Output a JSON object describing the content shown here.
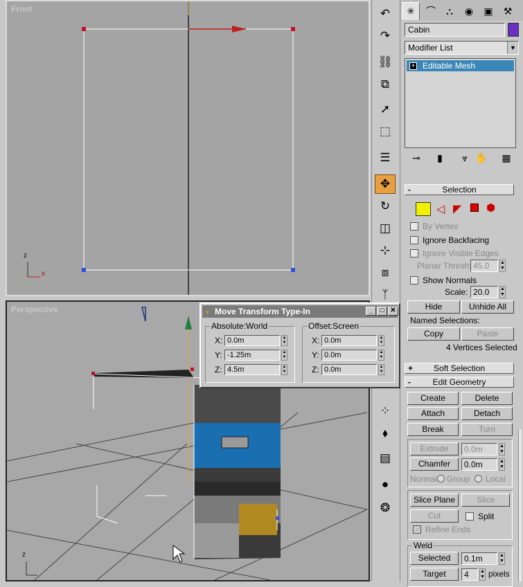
{
  "viewports": {
    "front": {
      "label": "Front",
      "axis_z": "z",
      "axis_x": "x"
    },
    "perspective": {
      "label": "Perspective",
      "axis_z": "z"
    }
  },
  "panel": {
    "object_name": "Cabin",
    "object_color": "#6a2fc0",
    "modifier_list": "Modifier List",
    "stack_item": "Editable Mesh",
    "selection": {
      "title": "Selection",
      "by_vertex": "By Vertex",
      "ignore_backfacing": "Ignore Backfacing",
      "ignore_visible_edges": "Ignore Visible Edges",
      "planar_thresh_label": "Planar Thresh:",
      "planar_thresh_value": "45.0",
      "show_normals": "Show Normals",
      "scale_label": "Scale:",
      "scale_value": "20.0",
      "hide": "Hide",
      "unhide_all": "Unhide All",
      "named_selections": "Named Selections:",
      "copy": "Copy",
      "paste": "Paste",
      "status": "4 Vertices Selected"
    },
    "soft_selection": {
      "title": "Soft Selection"
    },
    "edit_geometry": {
      "title": "Edit Geometry",
      "create": "Create",
      "delete": "Delete",
      "attach": "Attach",
      "detach": "Detach",
      "break": "Break",
      "turn": "Turn",
      "extrude": "Extrude",
      "extrude_value": "0.0m",
      "chamfer": "Chamfer",
      "chamfer_value": "0.0m",
      "normal_label": "Normal:",
      "group": "Group",
      "local": "Local",
      "slice_plane": "Slice Plane",
      "slice": "Slice",
      "cut": "Cut",
      "split": "Split",
      "refine_ends": "Refine Ends",
      "weld_label": "Weld",
      "selected": "Selected",
      "selected_value": "0.1m",
      "target": "Target",
      "target_value": "4",
      "pixels": "pixels"
    }
  },
  "dialog": {
    "title": "Move Transform Type-In",
    "absolute_title": "Absolute:World",
    "offset_title": "Offset:Screen",
    "abs": {
      "x": "0.0m",
      "y": "-1.25m",
      "z": "4.5m"
    },
    "off": {
      "x": "0.0m",
      "y": "0.0m",
      "z": "0.0m"
    },
    "x_label": "X:",
    "y_label": "Y:",
    "z_label": "Z:"
  },
  "colors": {
    "accent": "#3b86b8",
    "active_tool": "#e8a040",
    "vertex_sel": "#c0102a",
    "vertex": "#3050e0"
  }
}
